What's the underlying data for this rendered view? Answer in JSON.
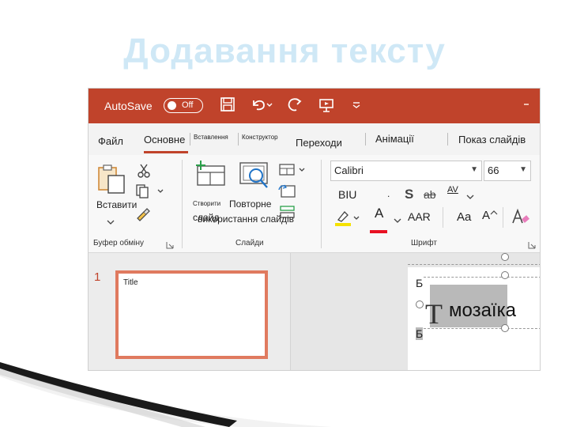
{
  "slide": {
    "title": "Додавання тексту"
  },
  "titlebar": {
    "autosave": "AutoSave",
    "toggle": "Off"
  },
  "tabs": [
    "Файл",
    "Основне",
    "Вставлення",
    "Конструктор",
    "Переходи",
    "Анімації",
    "Показ слайдів"
  ],
  "ribbon": {
    "clipboard": {
      "paste": "Вставити",
      "group": "Буфер обміну"
    },
    "slides": {
      "create_1": "Створити",
      "create_2": "слайд",
      "reuse_1": "Повторне",
      "reuse_2": "використання слайдів",
      "group": "Слайди"
    },
    "font": {
      "name": "Calibri",
      "size": "66",
      "biu": "BIU",
      "strike_s": "S",
      "strike_ab": "ab",
      "spacing": "AV",
      "aar": "AAR",
      "aa": "Aa",
      "grow": "A",
      "group": "Шрифт",
      "color_a": "A"
    }
  },
  "thumbnails": {
    "slide_number": "1",
    "slide_title": "Title"
  },
  "editor": {
    "t_letter": "T",
    "word": "мозаїка",
    "b_top": "Б",
    "b_bottom": "Б"
  },
  "colors": {
    "accent": "#c0432b",
    "highlight": "#f5e100",
    "font_color": "#e81123"
  }
}
